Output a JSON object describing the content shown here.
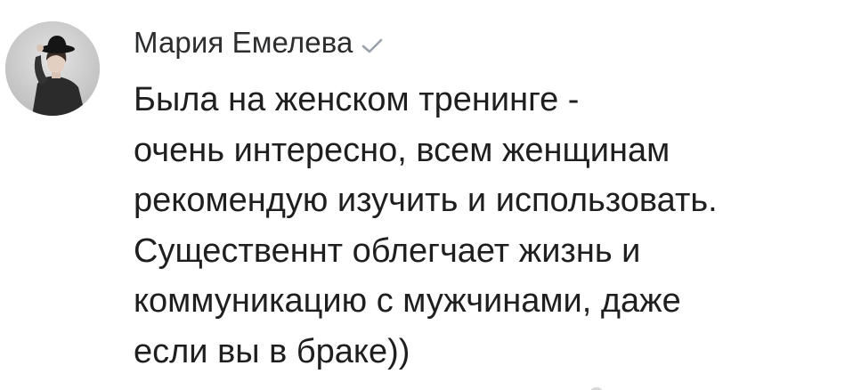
{
  "comment": {
    "author": "Мария Емелева",
    "verified_icon": "checkmark-icon",
    "avatar_icon": "user-avatar",
    "text": "Была на женском тренинге -\nочень интересно, всем женщинам\nрекомендую изучить и использовать.\nСущественнт облегчает жизнь и\nкоммуникацию с мужчинами, даже\nесли вы в браке))"
  },
  "colors": {
    "author": "#2c2d2e",
    "text": "#1f1f1f",
    "verified": "#99a2ad",
    "background": "#ffffff"
  }
}
